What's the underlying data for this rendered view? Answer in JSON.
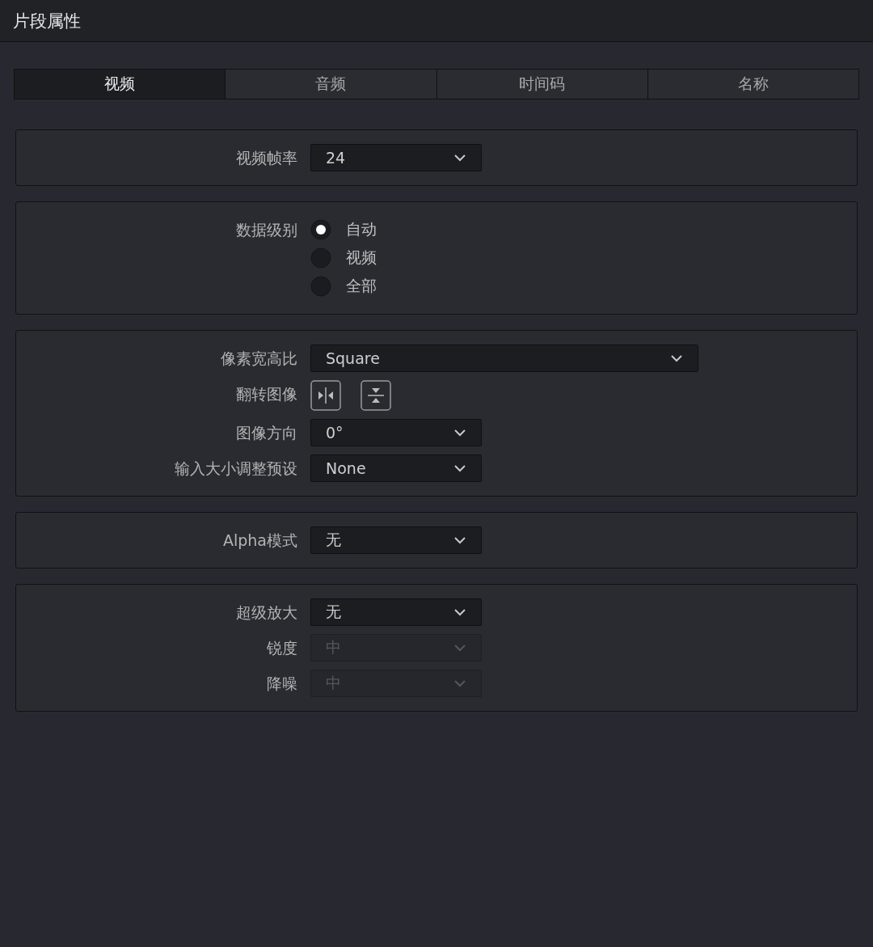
{
  "window": {
    "title": "片段属性"
  },
  "tabs": [
    {
      "label": "视频",
      "selected": true
    },
    {
      "label": "音频",
      "selected": false
    },
    {
      "label": "时间码",
      "selected": false
    },
    {
      "label": "名称",
      "selected": false
    }
  ],
  "sections": [
    {
      "rows": [
        {
          "kind": "dropdown",
          "label": "视频帧率",
          "value": "24",
          "disabled": false
        }
      ]
    },
    {
      "rows": [
        {
          "kind": "radio",
          "label": "数据级别",
          "options": [
            {
              "label": "自动",
              "selected": true
            },
            {
              "label": "视频",
              "selected": false
            },
            {
              "label": "全部",
              "selected": false
            }
          ]
        }
      ]
    },
    {
      "rows": [
        {
          "kind": "wide_dropdown",
          "label": "像素宽高比",
          "value": "Square",
          "disabled": false
        },
        {
          "kind": "flip",
          "label": "翻转图像"
        },
        {
          "kind": "dropdown",
          "label": "图像方向",
          "value": "0°",
          "disabled": false
        },
        {
          "kind": "dropdown",
          "label": "输入大小调整预设",
          "value": "None",
          "disabled": false
        }
      ]
    },
    {
      "rows": [
        {
          "kind": "dropdown",
          "label": "Alpha模式",
          "value": "无",
          "disabled": false
        }
      ]
    },
    {
      "rows": [
        {
          "kind": "dropdown",
          "label": "超级放大",
          "value": "无",
          "disabled": false
        },
        {
          "kind": "dropdown",
          "label": "锐度",
          "value": "中",
          "disabled": true
        },
        {
          "kind": "dropdown",
          "label": "降噪",
          "value": "中",
          "disabled": true
        }
      ]
    }
  ]
}
